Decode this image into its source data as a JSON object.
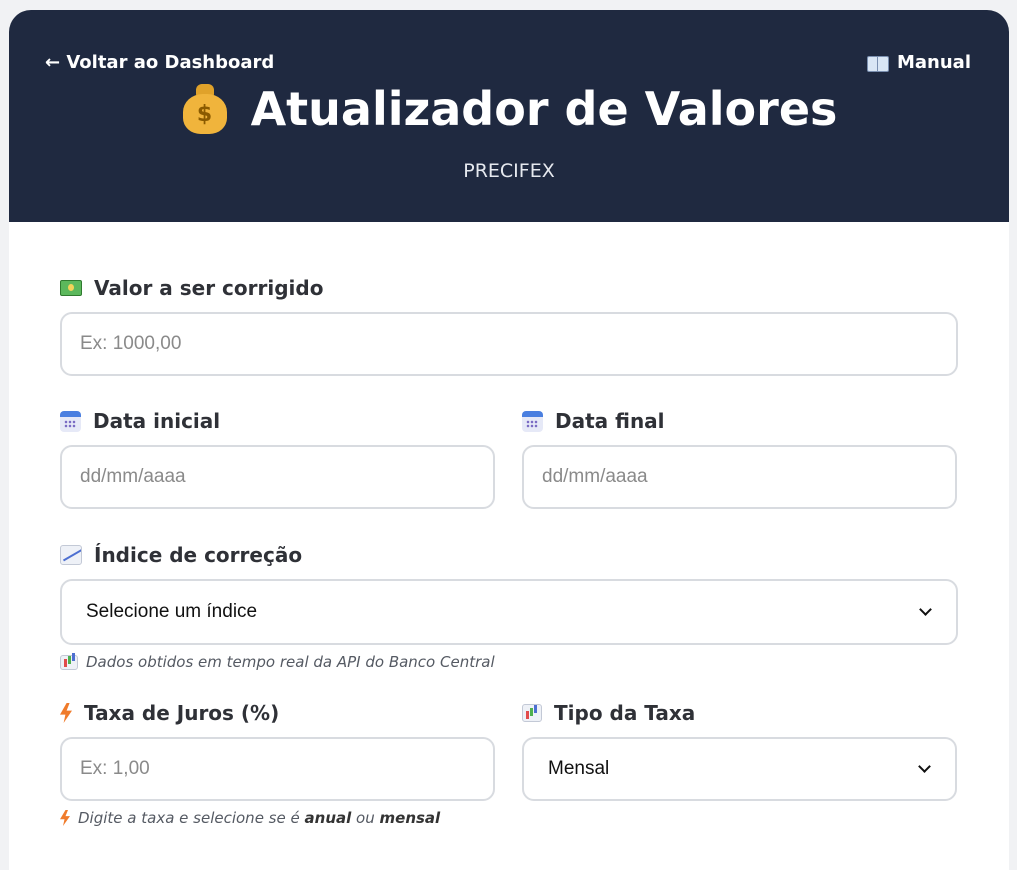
{
  "header": {
    "back_label": "← Voltar ao Dashboard",
    "manual_label": "Manual",
    "title": "Atualizador de Valores",
    "subtitle": "PRECIFEX",
    "bag_symbol": "$"
  },
  "form": {
    "valor": {
      "label": "Valor a ser corrigido",
      "placeholder": "Ex: 1000,00"
    },
    "data_inicial": {
      "label": "Data inicial",
      "placeholder": "dd/mm/aaaa"
    },
    "data_final": {
      "label": "Data final",
      "placeholder": "dd/mm/aaaa"
    },
    "indice": {
      "label": "Índice de correção",
      "selected": "Selecione um índice",
      "hint": "Dados obtidos em tempo real da API do Banco Central"
    },
    "taxa": {
      "label": "Taxa de Juros (%)",
      "placeholder": "Ex: 1,00"
    },
    "tipo_taxa": {
      "label": "Tipo da Taxa",
      "selected": "Mensal"
    },
    "taxa_hint": {
      "prefix": "Digite a taxa e selecione se é",
      "anual": "anual",
      "ou": "ou",
      "mensal": "mensal"
    }
  },
  "colors": {
    "header_bg": "#1f2940",
    "input_border": "#d8dbe0",
    "label_text": "#2f3137"
  },
  "icons": {
    "manual": "book-icon",
    "title": "moneybag-icon",
    "valor": "cash-icon",
    "datas": "calendar-icon",
    "indice": "chart-up-icon",
    "hint": "bar-chart-icon",
    "taxa": "bolt-icon",
    "tipo": "bar-chart-icon"
  }
}
